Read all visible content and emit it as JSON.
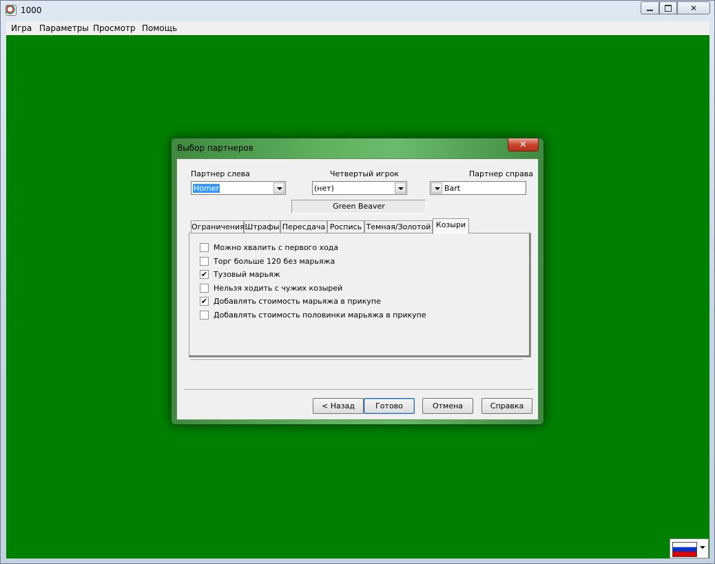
{
  "window": {
    "title": "1000",
    "menu": [
      "Игра",
      "Параметры",
      "Просмотр",
      "Помощь"
    ]
  },
  "dialog": {
    "title": "Выбор партнеров",
    "partner_left": {
      "label": "Партнер слева",
      "value": "Homer"
    },
    "fourth_player": {
      "label": "Четвертый игрок",
      "value": "(нет)",
      "status": "Green Beaver"
    },
    "partner_right": {
      "label": "Партнер справа",
      "value": "Bart"
    },
    "tabs": [
      "Ограничения",
      "Штрафы",
      "Пересдача",
      "Роспись",
      "Темная/Золотой",
      "Козыри"
    ],
    "active_tab": "Козыри",
    "options": [
      {
        "label": "Можно хвалить с первого хода",
        "checked": false
      },
      {
        "label": "Торг больше 120 без марьяжа",
        "checked": false
      },
      {
        "label": "Тузовый марьяж",
        "checked": true
      },
      {
        "label": "Нельзя ходить с чужих козырей",
        "checked": false
      },
      {
        "label": "Добавлять стоимость марьяжа в прикупе",
        "checked": true
      },
      {
        "label": "Добавлять стоимость половинки марьяжа в прикупе",
        "checked": false
      }
    ],
    "buttons": {
      "back": "< Назад",
      "done": "Готово",
      "cancel": "Отмена",
      "help": "Справка"
    },
    "close_glyph": "✕"
  },
  "language_flag": "russian-flag-icon",
  "colors": {
    "table_green": "#008000"
  }
}
